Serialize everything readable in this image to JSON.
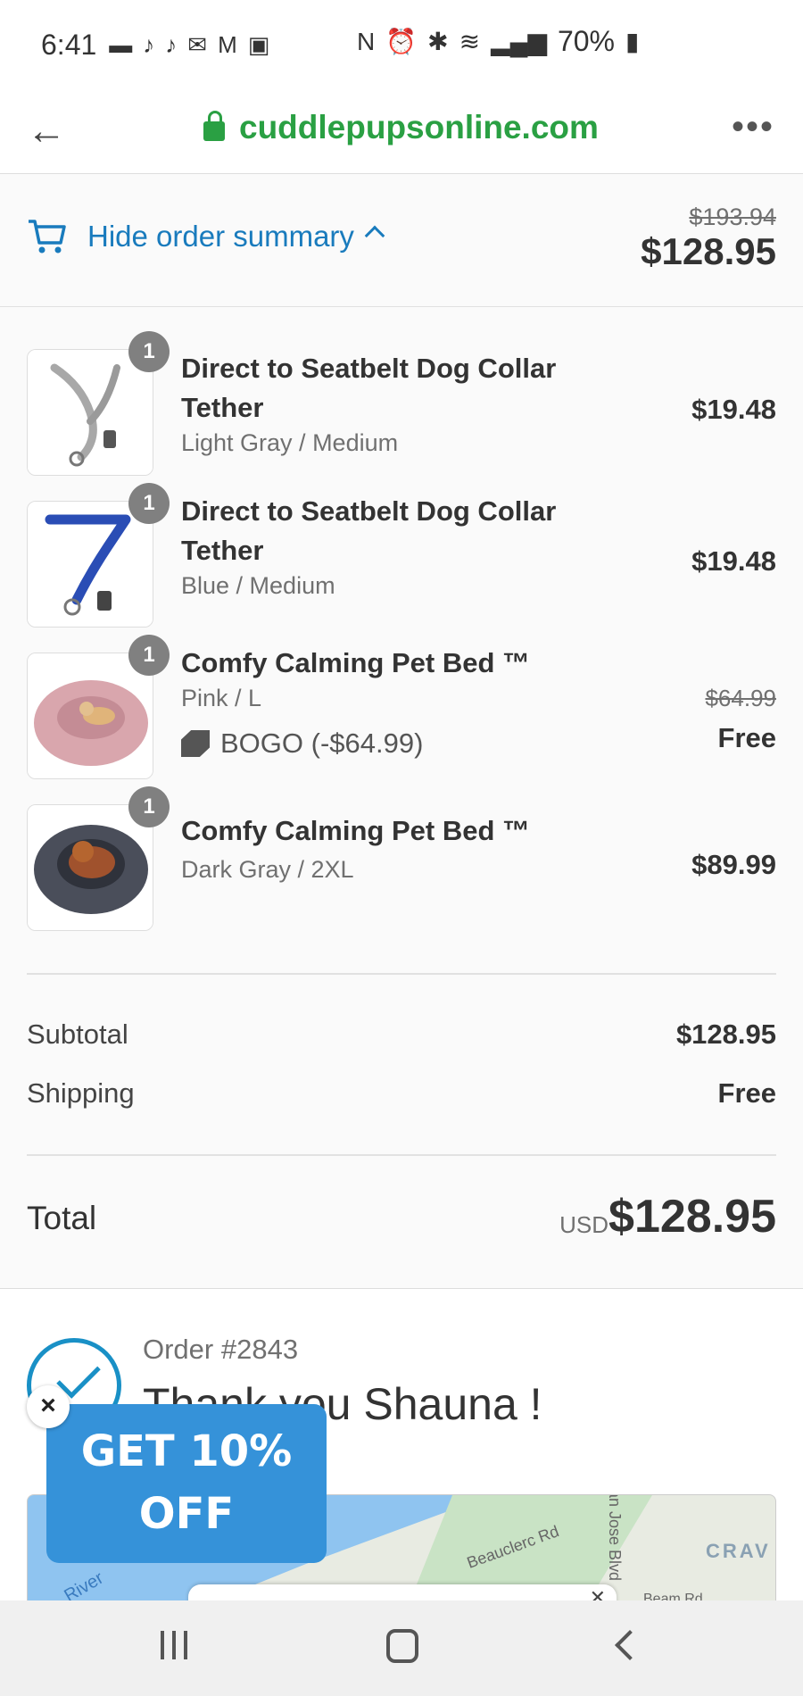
{
  "status_bar": {
    "time": "6:41",
    "battery": "70%"
  },
  "browser": {
    "url": "cuddlepupsonline.com"
  },
  "summary": {
    "toggle_label": "Hide order summary",
    "original_total": "$193.94",
    "total": "$128.95"
  },
  "items": [
    {
      "qty": "1",
      "name": "Direct to Seatbelt Dog Collar Tether",
      "variant": "Light Gray / Medium",
      "price": "$19.48"
    },
    {
      "qty": "1",
      "name": "Direct to Seatbelt Dog Collar Tether",
      "variant": "Blue / Medium",
      "price": "$19.48"
    },
    {
      "qty": "1",
      "name": "Comfy Calming Pet Bed ™",
      "variant": "Pink / L",
      "discount": "BOGO (-$64.99)",
      "original_price": "$64.99",
      "price": "Free"
    },
    {
      "qty": "1",
      "name": "Comfy Calming Pet Bed ™",
      "variant": "Dark Gray / 2XL",
      "price": "$89.99"
    }
  ],
  "totals": {
    "subtotal_label": "Subtotal",
    "subtotal_value": "$128.95",
    "shipping_label": "Shipping",
    "shipping_value": "Free",
    "total_label": "Total",
    "currency": "USD",
    "total_value": "$128.95"
  },
  "order": {
    "number": "Order #2843",
    "thanks": "Thank you Shauna !"
  },
  "map": {
    "labels": [
      "River",
      "Beauclerc Rd",
      "San Jose Blvd",
      "CRAV",
      "Beam Rd"
    ]
  },
  "promo": {
    "line1": "GET 10%",
    "line2": "OFF",
    "close": "×"
  },
  "colors": {
    "accent_blue": "#197bbd",
    "url_green": "#2aa043",
    "promo_blue": "#3592d9"
  }
}
